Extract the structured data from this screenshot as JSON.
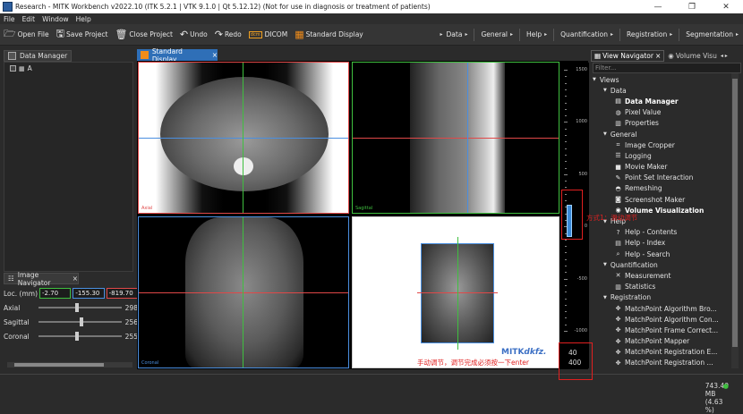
{
  "window": {
    "title": "Research - MITK Workbench v2022.10 (ITK 5.2.1 | VTK 9.1.0 | Qt 5.12.12) (Not for use in diagnosis or treatment of patients)",
    "minimize": "—",
    "maximize": "❐",
    "close": "✕"
  },
  "menu": [
    "File",
    "Edit",
    "Window",
    "Help"
  ],
  "toolbar": {
    "open_file": "Open File",
    "save_project": "Save Project",
    "close_project": "Close Project",
    "undo": "Undo",
    "redo": "Redo",
    "dicom": "DICOM",
    "standard_display": "Standard Display",
    "icon_dicom": "dcm"
  },
  "perspectives": [
    "Data",
    "General",
    "Help",
    "Quantification",
    "Registration",
    "Segmentation"
  ],
  "data_manager": {
    "tab": "Data Manager",
    "node": "A"
  },
  "standard_display": {
    "tab": "Standard Display",
    "close": "×"
  },
  "viewports": {
    "axial": "Axial",
    "sagittal": "Sagittal",
    "coronal": "Coronal"
  },
  "level_window": {
    "ticks": [
      "1500",
      "1000",
      "500",
      "0",
      "-500",
      "-1000"
    ],
    "level": "40",
    "window": "400",
    "level_fraction": 0.58
  },
  "watermark": {
    "mitk": "MITK",
    "dkfz": "dkfz."
  },
  "image_navigator": {
    "tab": "Image Navigator",
    "close": "×",
    "loc_label": "Loc. (mm)",
    "loc_x": "-2.70",
    "loc_y": "-155.30",
    "loc_z": "-819.70",
    "sliders": [
      {
        "label": "Axial",
        "value": "298",
        "pos": 0.45
      },
      {
        "label": "Sagittal",
        "value": "256",
        "pos": 0.5
      },
      {
        "label": "Coronal",
        "value": "255",
        "pos": 0.45
      }
    ]
  },
  "view_navigator": {
    "tab": "View Navigator",
    "close": "×",
    "tab2": "Volume Visu",
    "filter": "Filter...",
    "items": [
      {
        "text": "Views",
        "level": 0,
        "type": "cat"
      },
      {
        "text": "Data",
        "level": 1,
        "type": "cat"
      },
      {
        "text": "Data Manager",
        "level": 2,
        "icon": "data-manager-icon",
        "bold": true
      },
      {
        "text": "Pixel Value",
        "level": 2,
        "icon": "pixel-value-icon"
      },
      {
        "text": "Properties",
        "level": 2,
        "icon": "properties-icon"
      },
      {
        "text": "General",
        "level": 1,
        "type": "cat"
      },
      {
        "text": "Image Cropper",
        "level": 2,
        "icon": "cropper-icon"
      },
      {
        "text": "Logging",
        "level": 2,
        "icon": "logging-icon"
      },
      {
        "text": "Movie Maker",
        "level": 2,
        "icon": "movie-icon"
      },
      {
        "text": "Point Set Interaction",
        "level": 2,
        "icon": "pointset-icon"
      },
      {
        "text": "Remeshing",
        "level": 2,
        "icon": "remeshing-icon"
      },
      {
        "text": "Screenshot Maker",
        "level": 2,
        "icon": "screenshot-icon"
      },
      {
        "text": "Volume Visualization",
        "level": 2,
        "icon": "volume-icon",
        "bold": true
      },
      {
        "text": "Help",
        "level": 1,
        "type": "cat"
      },
      {
        "text": "Help - Contents",
        "level": 2,
        "icon": "help-icon"
      },
      {
        "text": "Help - Index",
        "level": 2,
        "icon": "index-icon"
      },
      {
        "text": "Help - Search",
        "level": 2,
        "icon": "search-icon"
      },
      {
        "text": "Quantification",
        "level": 1,
        "type": "cat"
      },
      {
        "text": "Measurement",
        "level": 2,
        "icon": "measurement-icon"
      },
      {
        "text": "Statistics",
        "level": 2,
        "icon": "statistics-icon"
      },
      {
        "text": "Registration",
        "level": 1,
        "type": "cat"
      },
      {
        "text": "MatchPoint Algorithm Bro...",
        "level": 2,
        "icon": "matchpoint-icon"
      },
      {
        "text": "MatchPoint Algorithm Con...",
        "level": 2,
        "icon": "matchpoint-icon"
      },
      {
        "text": "MatchPoint Frame Correct...",
        "level": 2,
        "icon": "matchpoint-icon"
      },
      {
        "text": "MatchPoint Mapper",
        "level": 2,
        "icon": "matchpoint-icon"
      },
      {
        "text": "MatchPoint Registration E...",
        "level": 2,
        "icon": "matchpoint-icon"
      },
      {
        "text": "MatchPoint Registration ...",
        "level": 2,
        "icon": "matchpoint-icon"
      }
    ]
  },
  "annotations": {
    "method1": "方式1：滑动调节",
    "manual": "手动调节，调节完成必须按一下enter"
  },
  "status": {
    "memory": "743.40 MB (4.63 %)"
  },
  "colors": {
    "accent": "#2f6fb7",
    "axial": "#e04848",
    "sagittal": "#3fbf3f",
    "coronal": "#4a8fe0",
    "annotation": "#e02020"
  }
}
